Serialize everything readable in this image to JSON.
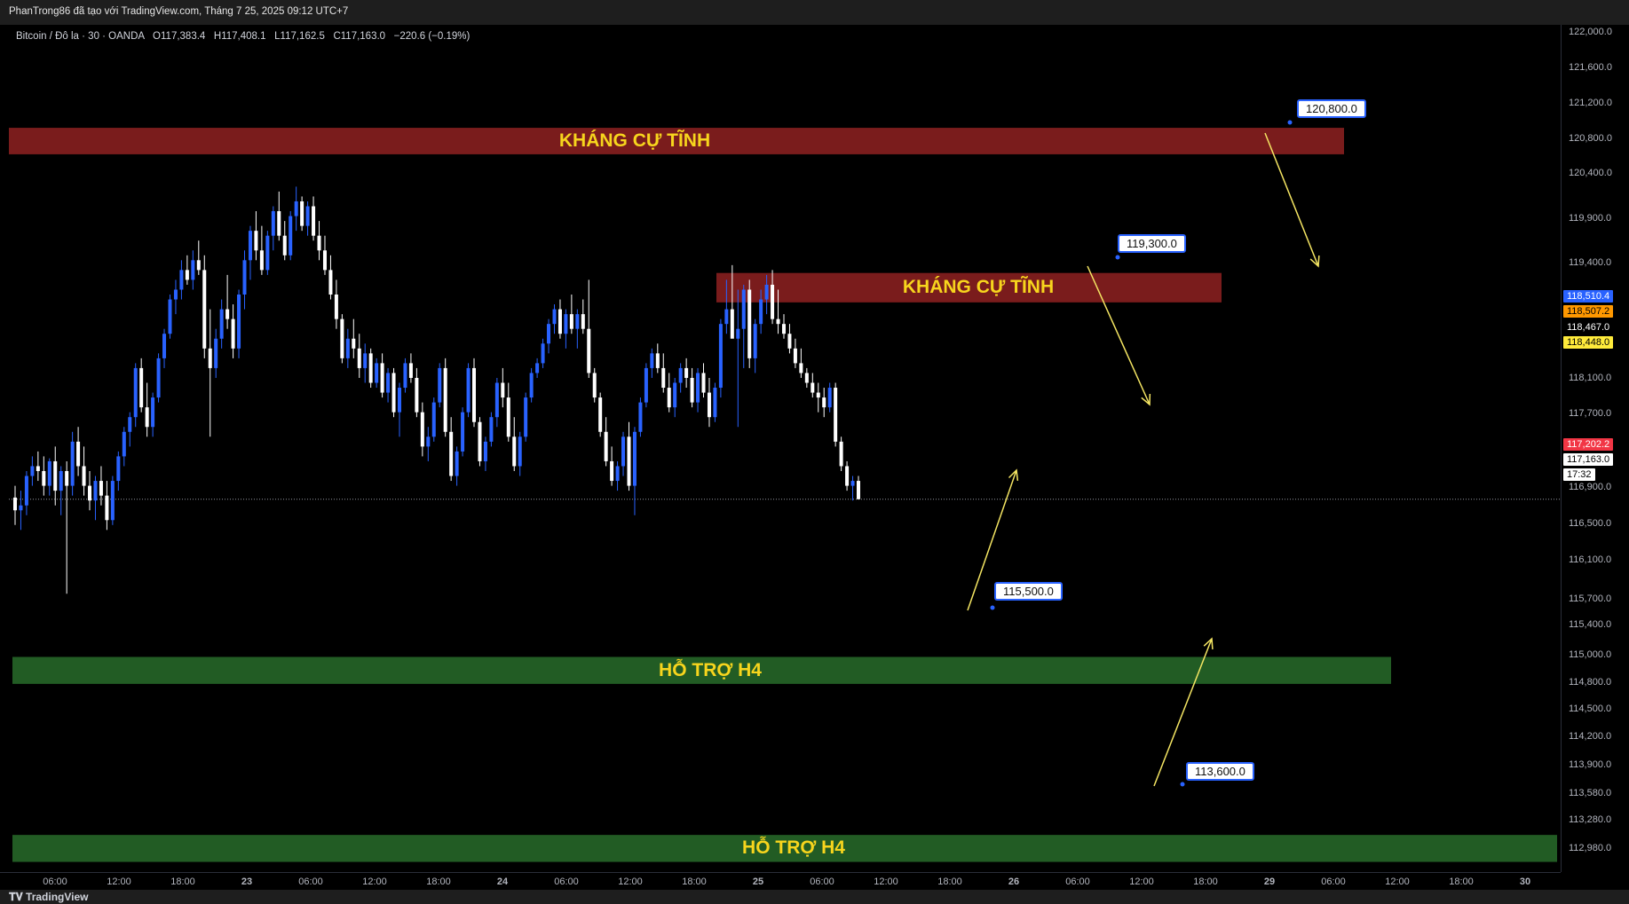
{
  "header": {
    "watermark": "PhanTrong86 đã tạo với TradingView.com, Tháng 7 25, 2025 09:12 UTC+7"
  },
  "legend": {
    "symbol": "Bitcoin / Đô la · 30 · OANDA",
    "open_label": "O",
    "open": "117,383.4",
    "high_label": "H",
    "high": "117,408.1",
    "low_label": "L",
    "low": "117,162.5",
    "close_label": "C",
    "close": "117,163.0",
    "change": "−220.6 (−0.19%)"
  },
  "colors": {
    "bull": "#2962ff",
    "bear": "#ffffff",
    "resistance_zone": "#7a1c1c",
    "support_zone": "#225c24",
    "label_text": "#f7d51d",
    "arrow": "#f5e663"
  },
  "price_axis": {
    "ticks": [
      "122,000.0",
      "121,600.0",
      "121,200.0",
      "120,800.0",
      "120,400.0",
      "119,900.0",
      "119,400.0",
      "118,100.0",
      "117,700.0",
      "116,900.0",
      "116,500.0",
      "116,100.0",
      "115,700.0",
      "115,400.0",
      "115,000.0",
      "114,800.0",
      "114,500.0",
      "114,200.0",
      "113,900.0",
      "113,580.0",
      "113,280.0",
      "112,980.0"
    ],
    "badges": [
      {
        "text": "118,510.4",
        "bg": "#2962ff",
        "fg": "#ffffff",
        "price": 118510.4
      },
      {
        "text": "118,507.2",
        "bg": "#ff9800",
        "fg": "#000000",
        "price": 118507.2
      },
      {
        "text": "118,467.0",
        "bg": "#000000",
        "fg": "#ffffff",
        "price": 118467.0
      },
      {
        "text": "118,448.0",
        "bg": "#ffeb3b",
        "fg": "#000000",
        "price": 118448.0
      },
      {
        "text": "117,202.2",
        "bg": "#f23645",
        "fg": "#ffffff",
        "price": 117202.2
      },
      {
        "text": "117,163.0",
        "bg": "#ffffff",
        "fg": "#000000",
        "price": 117163.0
      },
      {
        "text": "17:32",
        "bg": "#ffffff",
        "fg": "#000000",
        "price": 117163.0
      }
    ]
  },
  "time_axis": {
    "ticks": [
      "06:00",
      "12:00",
      "18:00",
      "23",
      "06:00",
      "12:00",
      "18:00",
      "24",
      "06:00",
      "12:00",
      "18:00",
      "25",
      "06:00",
      "12:00",
      "18:00",
      "26",
      "06:00",
      "12:00",
      "18:00",
      "29",
      "06:00",
      "12:00",
      "18:00",
      "30"
    ]
  },
  "annotations": {
    "zones": [
      {
        "label": "KHÁNG CỰ TĨNH",
        "type": "resistance",
        "price_top": 120950,
        "price_bottom": 120680
      },
      {
        "label": "KHÁNG CỰ TĨNH",
        "type": "resistance",
        "price_top": 119470,
        "price_bottom": 119170
      },
      {
        "label": "HỖ TRỢ H4",
        "type": "support",
        "price_top": 115555,
        "price_bottom": 115280
      },
      {
        "label": "HỖ TRỢ H4",
        "type": "support",
        "price_top": 113740,
        "price_bottom": 113465
      }
    ],
    "callouts": [
      "120,800.0",
      "119,300.0",
      "115,500.0",
      "113,600.0"
    ]
  },
  "footer": {
    "brand": "TradingView"
  },
  "chart_data": {
    "type": "candlestick",
    "symbol": "Bitcoin / Đô la",
    "interval": "30",
    "ylim": [
      112900,
      122100
    ],
    "last_price": 117163.0,
    "ohlc": [
      [
        117180,
        117300,
        116900,
        117050
      ],
      [
        117050,
        117250,
        116850,
        117100
      ],
      [
        117100,
        117450,
        117000,
        117400
      ],
      [
        117400,
        117600,
        117300,
        117500
      ],
      [
        117500,
        117650,
        117350,
        117450
      ],
      [
        117450,
        117600,
        117200,
        117300
      ],
      [
        117300,
        117580,
        117200,
        117550
      ],
      [
        117550,
        117700,
        117100,
        117250
      ],
      [
        117250,
        117500,
        117000,
        117450
      ],
      [
        117450,
        117550,
        116200,
        117300
      ],
      [
        117300,
        117850,
        117200,
        117750
      ],
      [
        117750,
        117900,
        117400,
        117500
      ],
      [
        117500,
        117700,
        117200,
        117300
      ],
      [
        117300,
        117450,
        117050,
        117150
      ],
      [
        117150,
        117400,
        116950,
        117350
      ],
      [
        117350,
        117500,
        117100,
        117200
      ],
      [
        117200,
        117350,
        116850,
        116950
      ],
      [
        116950,
        117400,
        116900,
        117350
      ],
      [
        117350,
        117650,
        117250,
        117600
      ],
      [
        117600,
        117900,
        117500,
        117850
      ],
      [
        117850,
        118050,
        117700,
        118000
      ],
      [
        118000,
        118550,
        117900,
        118500
      ],
      [
        118500,
        118600,
        118050,
        118100
      ],
      [
        118100,
        118350,
        117800,
        117900
      ],
      [
        117900,
        118250,
        117800,
        118200
      ],
      [
        118200,
        118650,
        118150,
        118600
      ],
      [
        118600,
        118900,
        118500,
        118850
      ],
      [
        118850,
        119250,
        118800,
        119200
      ],
      [
        119200,
        119400,
        119050,
        119300
      ],
      [
        119300,
        119600,
        119200,
        119500
      ],
      [
        119500,
        119650,
        119350,
        119400
      ],
      [
        119400,
        119700,
        119300,
        119600
      ],
      [
        119600,
        119800,
        119450,
        119500
      ],
      [
        119500,
        119650,
        118600,
        118700
      ],
      [
        118700,
        119100,
        117800,
        118500
      ],
      [
        118500,
        118900,
        118400,
        118800
      ],
      [
        118800,
        119200,
        118700,
        119100
      ],
      [
        119100,
        119450,
        118900,
        119000
      ],
      [
        119000,
        119150,
        118600,
        118700
      ],
      [
        118700,
        119300,
        118600,
        119250
      ],
      [
        119250,
        119700,
        119100,
        119600
      ],
      [
        119600,
        119950,
        119400,
        119900
      ],
      [
        119900,
        120100,
        119600,
        119700
      ],
      [
        119700,
        119950,
        119450,
        119500
      ],
      [
        119500,
        119900,
        119450,
        119850
      ],
      [
        119850,
        120150,
        119700,
        120100
      ],
      [
        120100,
        120300,
        119800,
        119850
      ],
      [
        119850,
        120000,
        119600,
        119650
      ],
      [
        119650,
        120100,
        119600,
        120050
      ],
      [
        120050,
        120350,
        119900,
        120200
      ],
      [
        120200,
        120250,
        119900,
        119950
      ],
      [
        119950,
        120200,
        119850,
        120150
      ],
      [
        120150,
        120250,
        119800,
        119850
      ],
      [
        119850,
        120000,
        119600,
        119700
      ],
      [
        119700,
        119850,
        119450,
        119500
      ],
      [
        119500,
        119650,
        119200,
        119250
      ],
      [
        119250,
        119400,
        118900,
        119000
      ],
      [
        119000,
        119050,
        118550,
        118600
      ],
      [
        118600,
        118900,
        118500,
        118800
      ],
      [
        118800,
        119000,
        118600,
        118700
      ],
      [
        118700,
        118850,
        118400,
        118500
      ],
      [
        118500,
        118750,
        118350,
        118650
      ],
      [
        118650,
        118700,
        118300,
        118350
      ],
      [
        118350,
        118600,
        118300,
        118550
      ],
      [
        118550,
        118650,
        118200,
        118250
      ],
      [
        118250,
        118500,
        118150,
        118450
      ],
      [
        118450,
        118500,
        118000,
        118050
      ],
      [
        118050,
        118350,
        117800,
        118300
      ],
      [
        118300,
        118600,
        118250,
        118550
      ],
      [
        118550,
        118650,
        118350,
        118400
      ],
      [
        118400,
        118500,
        118000,
        118050
      ],
      [
        118050,
        118150,
        117600,
        117700
      ],
      [
        117700,
        117900,
        117550,
        117800
      ],
      [
        117800,
        118200,
        117750,
        118150
      ],
      [
        118150,
        118550,
        118100,
        118500
      ],
      [
        118500,
        118600,
        117800,
        117850
      ],
      [
        117850,
        118000,
        117350,
        117400
      ],
      [
        117400,
        117700,
        117300,
        117650
      ],
      [
        117650,
        118100,
        117600,
        118050
      ],
      [
        118050,
        118550,
        118000,
        118500
      ],
      [
        118500,
        118600,
        117900,
        117950
      ],
      [
        117950,
        118000,
        117500,
        117550
      ],
      [
        117550,
        117800,
        117450,
        117750
      ],
      [
        117750,
        118050,
        117700,
        118000
      ],
      [
        118000,
        118400,
        117900,
        118350
      ],
      [
        118350,
        118500,
        118100,
        118200
      ],
      [
        118200,
        118350,
        117750,
        117800
      ],
      [
        117800,
        118000,
        117450,
        117500
      ],
      [
        117500,
        117850,
        117400,
        117800
      ],
      [
        117800,
        118250,
        117750,
        118200
      ],
      [
        118200,
        118500,
        118150,
        118450
      ],
      [
        118450,
        118600,
        118400,
        118550
      ],
      [
        118550,
        118800,
        118500,
        118750
      ],
      [
        118750,
        119000,
        118650,
        118950
      ],
      [
        118950,
        119150,
        118850,
        119100
      ],
      [
        119100,
        119200,
        118800,
        118850
      ],
      [
        118850,
        119100,
        118700,
        119050
      ],
      [
        119050,
        119250,
        118850,
        118900
      ],
      [
        118900,
        119100,
        118700,
        119050
      ],
      [
        119050,
        119200,
        118850,
        118900
      ],
      [
        118900,
        119400,
        118400,
        118450
      ],
      [
        118450,
        118500,
        118150,
        118200
      ],
      [
        118200,
        118250,
        117800,
        117850
      ],
      [
        117850,
        118000,
        117500,
        117550
      ],
      [
        117550,
        117700,
        117300,
        117350
      ],
      [
        117350,
        117550,
        117250,
        117500
      ],
      [
        117500,
        117850,
        117400,
        117800
      ],
      [
        117800,
        117950,
        117250,
        117300
      ],
      [
        117300,
        117900,
        117000,
        117850
      ],
      [
        117850,
        118200,
        117800,
        118150
      ],
      [
        118150,
        118550,
        118100,
        118500
      ],
      [
        118500,
        118700,
        118400,
        118650
      ],
      [
        118650,
        118750,
        118450,
        118500
      ],
      [
        118500,
        118650,
        118250,
        118300
      ],
      [
        118300,
        118450,
        118050,
        118100
      ],
      [
        118100,
        118400,
        118000,
        118350
      ],
      [
        118350,
        118550,
        118250,
        118500
      ],
      [
        118500,
        118600,
        118300,
        118400
      ],
      [
        118400,
        118500,
        118100,
        118150
      ],
      [
        118150,
        118500,
        118050,
        118450
      ],
      [
        118450,
        118550,
        118200,
        118250
      ],
      [
        118250,
        118400,
        117900,
        118000
      ],
      [
        118000,
        118350,
        117950,
        118300
      ],
      [
        118300,
        119000,
        118200,
        118950
      ],
      [
        118950,
        119400,
        118850,
        119100
      ],
      [
        119100,
        119550,
        118950,
        118800
      ],
      [
        118800,
        119300,
        117900,
        118900
      ],
      [
        118900,
        119350,
        118500,
        119300
      ],
      [
        119300,
        119400,
        118500,
        118600
      ],
      [
        118600,
        119000,
        118450,
        118950
      ],
      [
        118950,
        119300,
        118850,
        119200
      ],
      [
        119200,
        119450,
        119050,
        119350
      ],
      [
        119350,
        119500,
        118950,
        119000
      ],
      [
        119000,
        119300,
        118850,
        118950
      ],
      [
        118950,
        119050,
        118800,
        118850
      ],
      [
        118850,
        118950,
        118650,
        118700
      ],
      [
        118700,
        118800,
        118500,
        118550
      ],
      [
        118550,
        118700,
        118400,
        118450
      ],
      [
        118450,
        118500,
        118300,
        118350
      ],
      [
        118350,
        118450,
        118200,
        118250
      ],
      [
        118250,
        118350,
        118050,
        118200
      ],
      [
        118200,
        118300,
        118000,
        118100
      ],
      [
        118100,
        118350,
        118050,
        118300
      ],
      [
        118300,
        118350,
        117700,
        117750
      ],
      [
        117750,
        117800,
        117450,
        117500
      ],
      [
        117500,
        117550,
        117250,
        117300
      ],
      [
        117300,
        117400,
        117150,
        117350
      ],
      [
        117350,
        117400,
        117160,
        117163
      ]
    ]
  }
}
